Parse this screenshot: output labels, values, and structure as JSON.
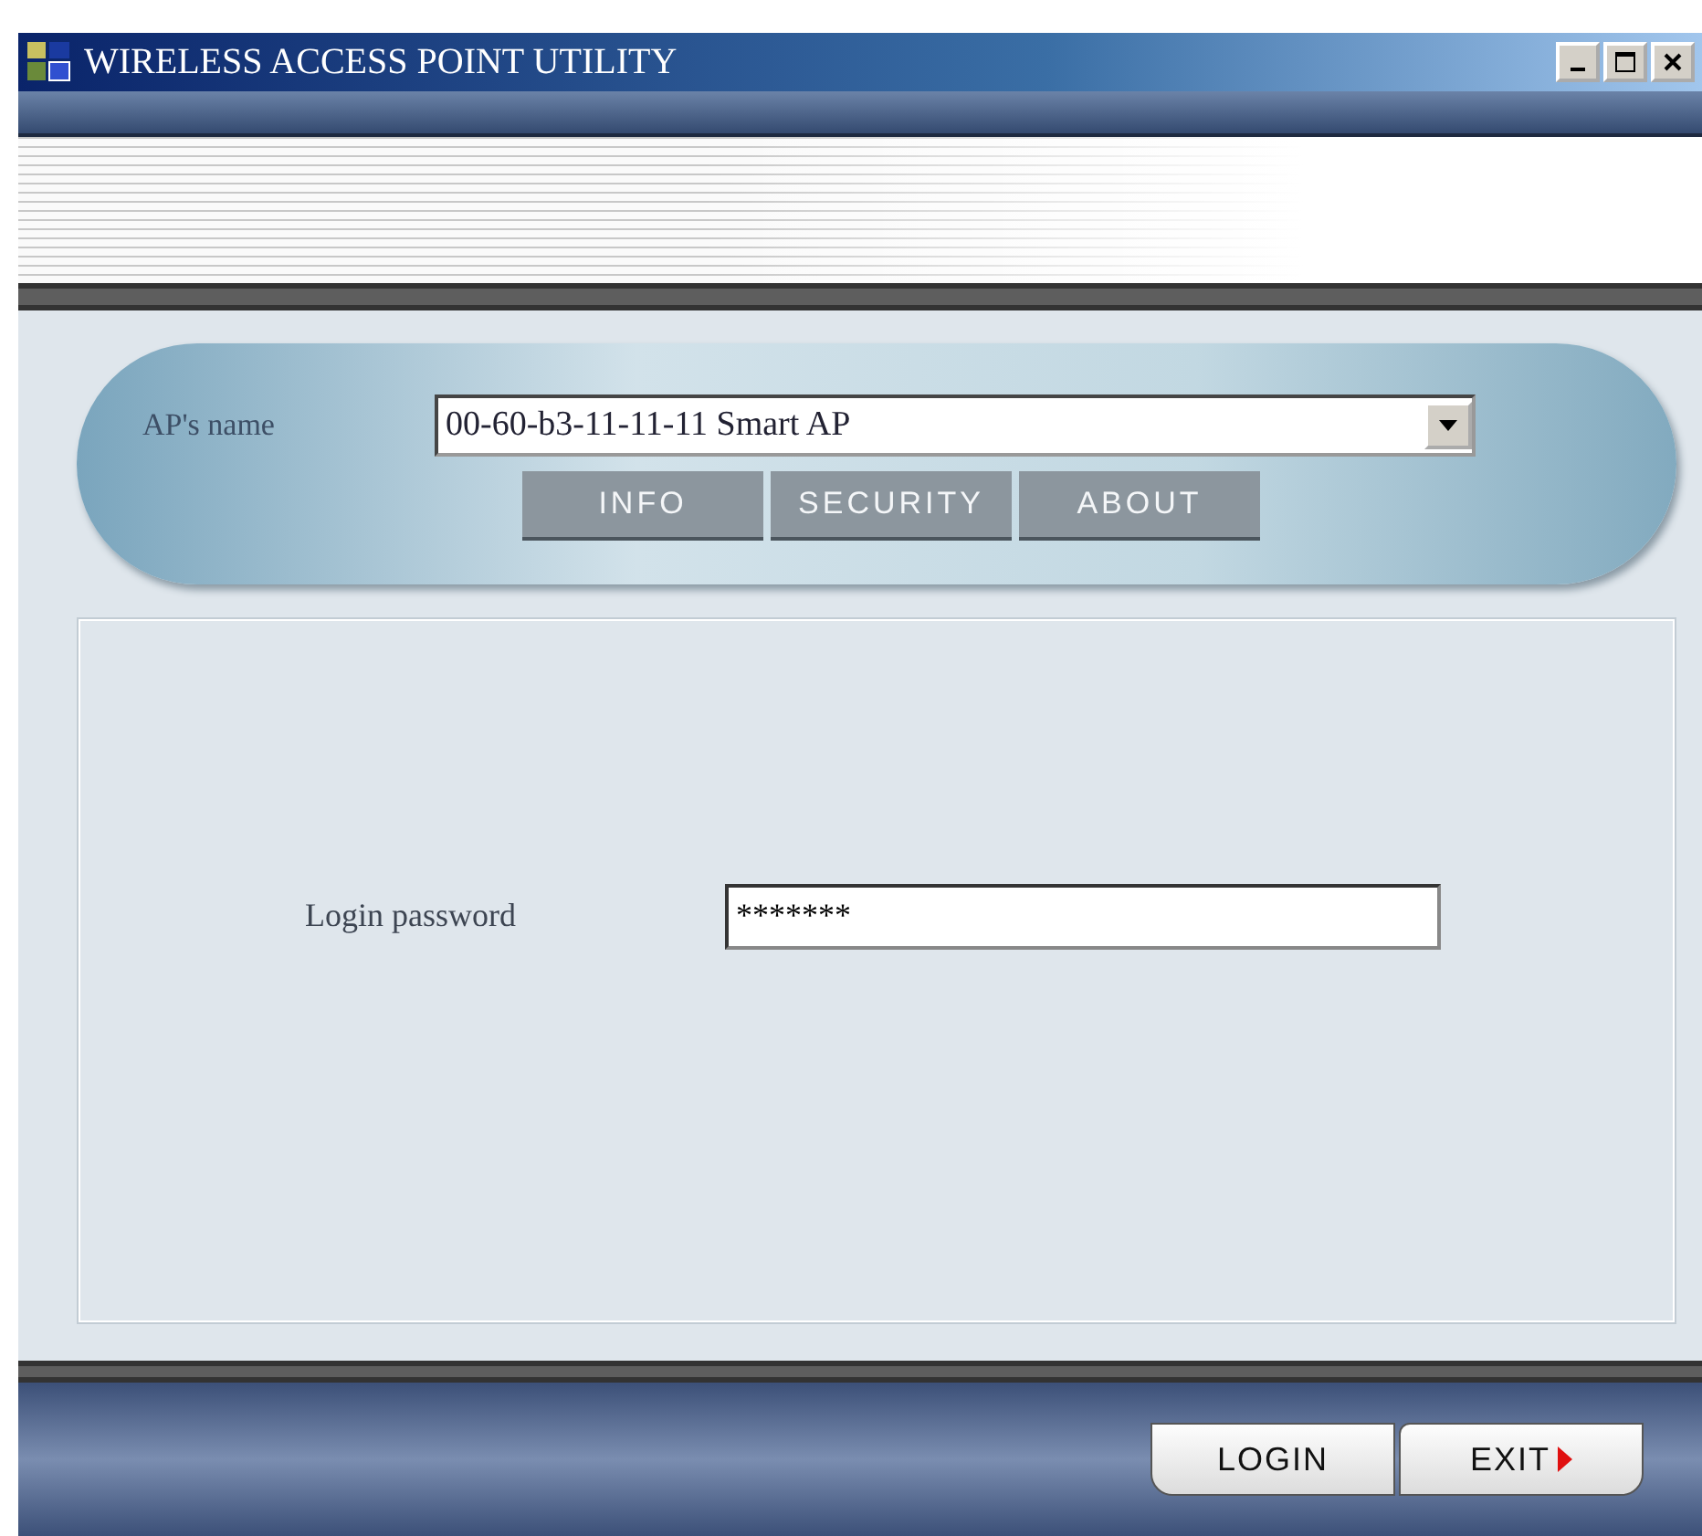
{
  "window": {
    "title": "WIRELESS ACCESS POINT UTILITY"
  },
  "ap_selector": {
    "label": "AP's name",
    "value": "00-60-b3-11-11-11 Smart AP"
  },
  "tabs": [
    {
      "label": "INFO"
    },
    {
      "label": "SECURITY"
    },
    {
      "label": "ABOUT"
    }
  ],
  "login": {
    "label": "Login password",
    "value": "*******"
  },
  "buttons": [
    {
      "label": "LOGIN",
      "kind": "plain"
    },
    {
      "label": "EXIT",
      "kind": "arrow"
    }
  ]
}
